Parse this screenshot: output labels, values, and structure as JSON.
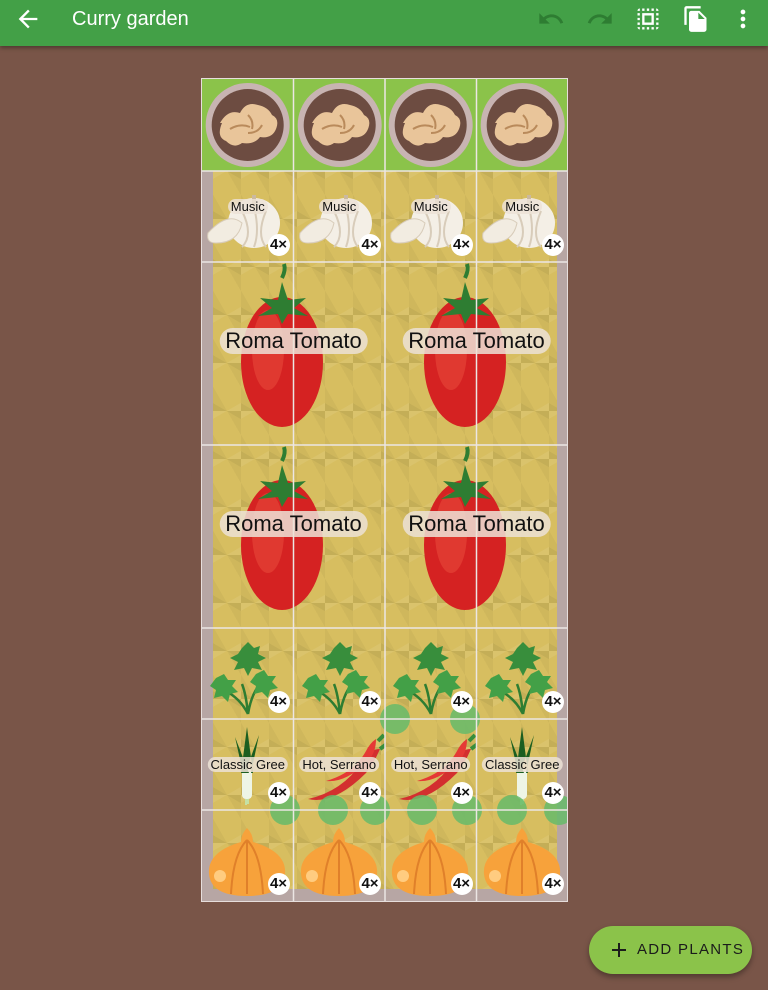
{
  "appbar": {
    "title": "Curry garden",
    "icons": [
      "arrow-back-icon",
      "undo-icon",
      "redo-icon",
      "select-all-icon",
      "copy-icon",
      "more-vert-icon"
    ]
  },
  "bed": {
    "rows": [
      {
        "plant": "ginger",
        "cells": [
          {},
          {},
          {},
          {}
        ]
      },
      {
        "plant": "garlic",
        "cells": [
          {
            "label": "Music",
            "count": "4×"
          },
          {
            "label": "Music",
            "count": "4×"
          },
          {
            "label": "Music",
            "count": "4×"
          },
          {
            "label": "Music",
            "count": "4×"
          }
        ]
      },
      {
        "plant": "tomato",
        "cells": [
          {
            "label": "Roma Tomato"
          },
          {
            "label": "Roma Tomato"
          }
        ]
      },
      {
        "plant": "tomato",
        "cells": [
          {
            "label": "Roma Tomato"
          },
          {
            "label": "Roma Tomato"
          }
        ]
      },
      {
        "plant": "parsley",
        "cells": [
          {
            "count": "4×"
          },
          {
            "count": "4×"
          },
          {
            "count": "4×"
          },
          {
            "count": "4×"
          }
        ]
      },
      {
        "plant": "mixed",
        "cells": [
          {
            "kind": "leek",
            "label": "Classic Gree",
            "count": "4×"
          },
          {
            "kind": "pepper",
            "label": "Hot, Serrano",
            "count": "4×"
          },
          {
            "kind": "pepper",
            "label": "Hot, Serrano",
            "count": "4×"
          },
          {
            "kind": "leek",
            "label": "Classic Gree",
            "count": "4×"
          }
        ]
      },
      {
        "plant": "onion",
        "cells": [
          {
            "count": "4×"
          },
          {
            "count": "4×"
          },
          {
            "count": "4×"
          },
          {
            "count": "4×"
          }
        ]
      }
    ]
  },
  "fab": {
    "label": "ADD PLANTS",
    "icon": "plus-icon"
  },
  "colors": {
    "appbar": "#43a047",
    "background": "#795548",
    "fab": "#8bc34a"
  }
}
